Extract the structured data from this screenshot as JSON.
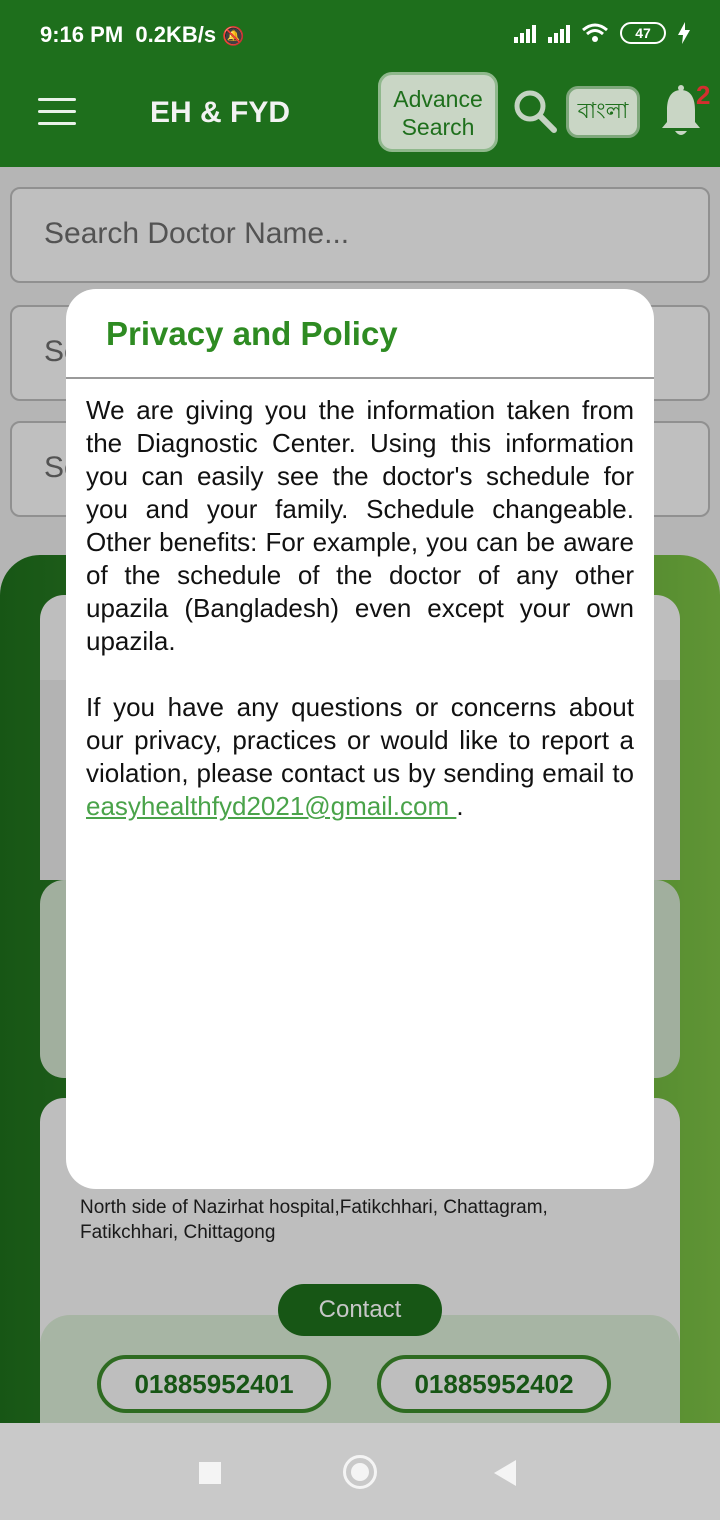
{
  "status_bar": {
    "time": "9:16 PM",
    "net_speed": "0.2KB/s",
    "battery": "47"
  },
  "app_bar": {
    "title": "EH & FYD",
    "advance_search_line1": "Advance",
    "advance_search_line2": "Search",
    "language_button": "বাংলা",
    "notification_count": "2"
  },
  "background": {
    "search_placeholder": "Search Doctor Name...",
    "select1_partial": "Se",
    "select2_partial": "Se",
    "address_line1": "North side of Nazirhat hospital,Fatikchhari, Chattagram,",
    "address_line2": "Fatikchhari, Chittagong",
    "contact_button": "Contact",
    "phones": [
      "01885952401",
      "01885952402"
    ]
  },
  "dialog": {
    "title": "Privacy and Policy",
    "paragraph1": "We are giving you the information taken from the Diagnostic Center. Using this information you can easily see the doctor's schedule for you and your family. Schedule changeable. Other benefits: For example, you can be aware of the schedule of the doctor of any other upazila (Bangladesh) even except your own upazila.",
    "paragraph2": "If you have any questions or concerns about our privacy, practices or would like to report a violation, please contact us by sending email to",
    "email": "easyhealthfyd2021@gmail.com ",
    "end_punct": "."
  },
  "icons": [
    "menu-icon",
    "search-icon",
    "bell-icon",
    "signal-icon",
    "wifi-icon",
    "battery-icon",
    "charging-icon",
    "mute-icon",
    "nav-recent-icon",
    "nav-home-icon",
    "nav-back-icon"
  ]
}
